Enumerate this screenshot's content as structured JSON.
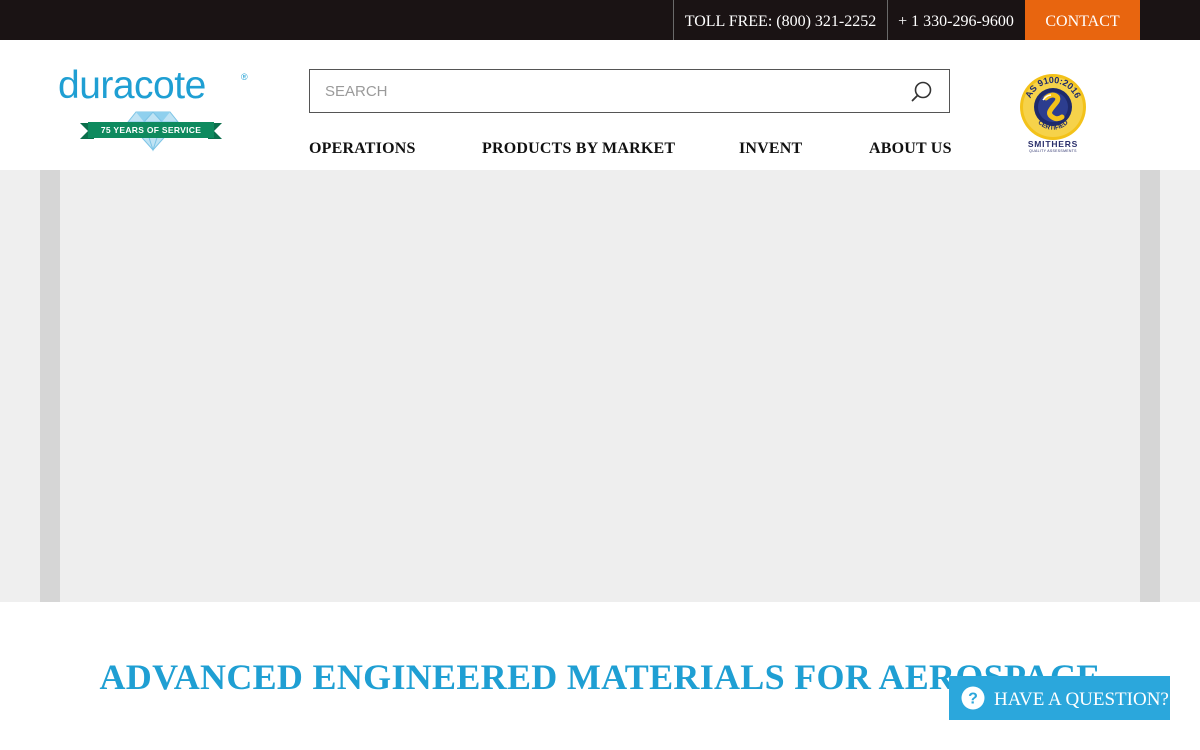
{
  "topbar": {
    "toll_free": "TOLL FREE: (800) 321-2252",
    "phone": "+ 1 330-296-9600",
    "contact": "CONTACT"
  },
  "logo": {
    "word": "duracote",
    "registered": "®",
    "ribbon": "75 YEARS OF SERVICE"
  },
  "search": {
    "placeholder": "SEARCH",
    "icon": "search-icon"
  },
  "nav": {
    "operations": "OPERATIONS",
    "products": "PRODUCTS BY MARKET",
    "invent": "INVENT",
    "about": "ABOUT US"
  },
  "certification": {
    "ring_text": "AS 9100:2016",
    "certified": "CERTIFIED",
    "issuer": "SMITHERS",
    "issuer_sub": "QUALITY ASSESSMENTS"
  },
  "headline": "ADVANCED ENGINEERED MATERIALS FOR AEROSPACE",
  "question_widget": {
    "label": "HAVE A QUESTION?",
    "icon": "question-circle-icon"
  },
  "colors": {
    "brand_blue": "#1f9fd3",
    "contact_orange": "#e8650f",
    "topbar_dark": "#1a1314",
    "ribbon_green": "#0e8a5e",
    "widget_blue": "#2ba7dc"
  }
}
